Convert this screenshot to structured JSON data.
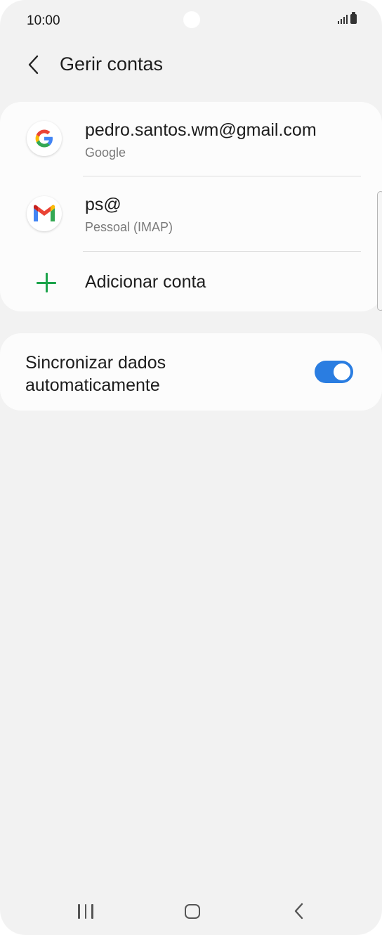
{
  "status_bar": {
    "time": "10:00"
  },
  "header": {
    "title": "Gerir contas"
  },
  "accounts": [
    {
      "name": "pedro.santos.wm@gmail.com",
      "type": "Google",
      "icon": "google-icon"
    },
    {
      "name": "ps@",
      "type": "Pessoal (IMAP)",
      "icon": "gmail-icon"
    }
  ],
  "add_account": {
    "label": "Adicionar conta",
    "icon": "plus-icon"
  },
  "sync": {
    "label": "Sincronizar dados automaticamente",
    "enabled": true
  },
  "colors": {
    "accent": "#2a7de1",
    "add_icon": "#1ba34a",
    "background": "#f2f2f2",
    "card": "#fcfcfc"
  }
}
